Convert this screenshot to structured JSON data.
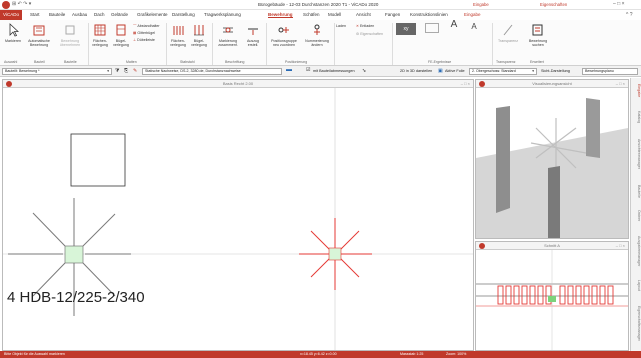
{
  "app": {
    "logo": "ViCADo",
    "window_title": "Bürogebäude - 12-03 Durchstanzen 2020 T1 - ViCADo 2020",
    "context_tab_1": "Eingabe",
    "context_tab_2": "Eigenschaften",
    "window_controls": "–  □  ×"
  },
  "tabs": [
    "Start",
    "Bauteile",
    "Ausbau",
    "Dach",
    "Gelände",
    "Grafikelemente",
    "Darstellung",
    "Tragwerksplanung",
    "Bewehrung",
    "Schäfen",
    "Modell",
    "Ansicht",
    "Fangen",
    "Konstruktionslinien",
    "Eingabe"
  ],
  "active_tab": "Bewehrung",
  "ribbon": {
    "buttons": {
      "markieren": "Markieren",
      "auto_bew": "Automatische Bewehrung",
      "bew_uebernehmen": "Bewehrung übernehmen",
      "flaechen": "Flächen-verlegung",
      "buegel": "Bügel-verlegung",
      "abstandhalter": "Abstandhalter",
      "gitterbuegel": "Gitterbügel",
      "duebelleiste": "Dübelleiste",
      "flaechen2": "Flächen-verlegung",
      "buegel2": "Bügel-verlegung",
      "markierung": "Markierung zusammenf.",
      "auszug": "Auszug erstell.",
      "positionsgruppe": "Positionsgruppe neu zuordnen",
      "nummerierung": "Nummerierung ändern",
      "laden": "Laden",
      "entladen": "Entladen",
      "eigenschaften": "Eigenschaften",
      "xy": "xy",
      "a1": "A",
      "a2": "A",
      "transparenz": "Transparenz",
      "bew_suchen": "Bewehrung suchen"
    },
    "groups": [
      "Auswahl",
      "Bauteil",
      "Bauteile",
      "Matten",
      "Stabstahl",
      "Beschriftung",
      "Positionierung",
      "FE-Ergebnisse",
      "Transparenz",
      "Erweitert"
    ]
  },
  "options_bar": {
    "object_select": "Bauteilt: Bewehrung *",
    "hint": "Statische Nachweise, DS-2, 3280.de, Durchstanznachweise",
    "checkbox_label": "mit Bauteilabmessungen",
    "view3d": "2D in 3D darstellen",
    "aktive_folie_label": "Aktive Folie",
    "aktive_folie_value": "2. Obergeschoss: Standard",
    "sicht_label": "Sicht-Darstellung",
    "sicht_value": "Bewehrungsplanu"
  },
  "panels": {
    "main_title": "Basis Recht 2.00",
    "visual_title": "Visualisierungsansicht",
    "section_title": "Schnitt A"
  },
  "annotation": "4 HDB-12/225-2/340",
  "sidebar_tabs": [
    "Eingabe",
    "Katalog",
    "Ansichtenmanager",
    "Bauteile",
    "Ordner",
    "Ausgabenmanager",
    "Layout",
    "Eigenschaftsmanager"
  ],
  "status": {
    "text": "Bitte Objekt für die Auswahl markieren",
    "coords": "x=18.45  y=6.42  z=0.00",
    "mass": "Massstab 1:25",
    "zoom": "Zoom: 100%"
  },
  "colors": {
    "accent": "#c0392b",
    "ribbon": "#fbfbfb",
    "rebar": "#e53935"
  }
}
